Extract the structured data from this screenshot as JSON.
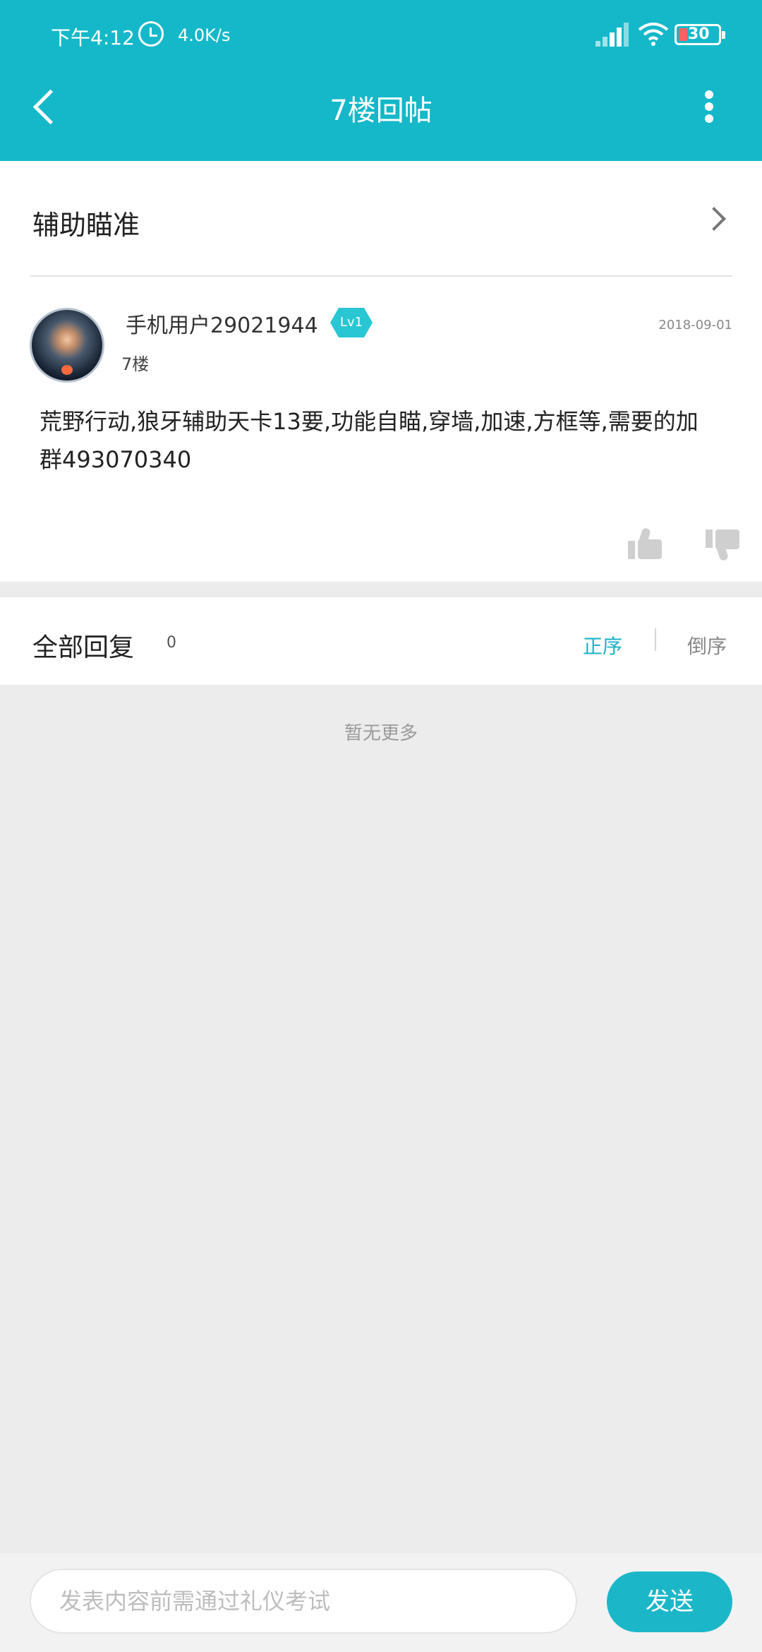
{
  "status_bar": {
    "time": "下午4:12",
    "speed": "4.0K/s",
    "battery": "30"
  },
  "header": {
    "title": "7楼回帖"
  },
  "topic": {
    "label": "辅助瞄准"
  },
  "post": {
    "username": "手机用户29021944",
    "level": "Lv1",
    "floor": "7楼",
    "date": "2018-09-01",
    "content": "荒野行动,狼牙辅助天卡13要,功能自瞄,穿墙,加速,方框等,需要的加群493070340"
  },
  "replies": {
    "title": "全部回复",
    "count": "0",
    "sort_asc": "正序",
    "sort_desc": "倒序"
  },
  "empty_text": "暂无更多",
  "composer": {
    "placeholder": "发表内容前需通过礼仪考试",
    "send_label": "发送"
  },
  "colors": {
    "accent": "#14b8c9",
    "active_sort": "#1bb2c4",
    "background": "#ececec"
  },
  "icons": [
    "back-arrow-icon",
    "more-vertical-icon",
    "chevron-right-icon",
    "thumbs-up-icon",
    "thumbs-down-icon",
    "alarm-icon",
    "signal-icon",
    "wifi-icon",
    "battery-icon"
  ]
}
